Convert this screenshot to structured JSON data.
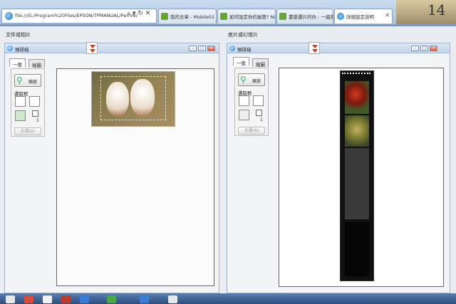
{
  "browser": {
    "address": "file:///G:/Program%20Files/EPSON/TPMANUAL/PerfV6/",
    "tabs": [
      {
        "label": "我的文章 - Mobile01"
      },
      {
        "label": "如何設定你的屋簷? Nik…"
      },
      {
        "label": "書愛選片的你 - 一組用…"
      },
      {
        "label": "詳細設定說明"
      }
    ],
    "right_digits": "14"
  },
  "left_panel": {
    "section_title": "文件或相片",
    "window_title": "預掃描",
    "tab_general": "一般",
    "tab_thumbnail": "縮圖",
    "zoom_button": "縮放",
    "selection_label": "選取框",
    "count": "1",
    "select_all": "全選(A)"
  },
  "right_panel": {
    "section_title": "底片或幻燈片",
    "window_title": "預掃描",
    "tab_general": "一般",
    "tab_thumbnail": "縮圖",
    "zoom_button": "縮放",
    "selection_label": "選取框",
    "count": "1",
    "select_all": "全選(A)"
  },
  "colors": {
    "accent_red": "#d23a1e",
    "window_border": "#9fb3cc"
  }
}
